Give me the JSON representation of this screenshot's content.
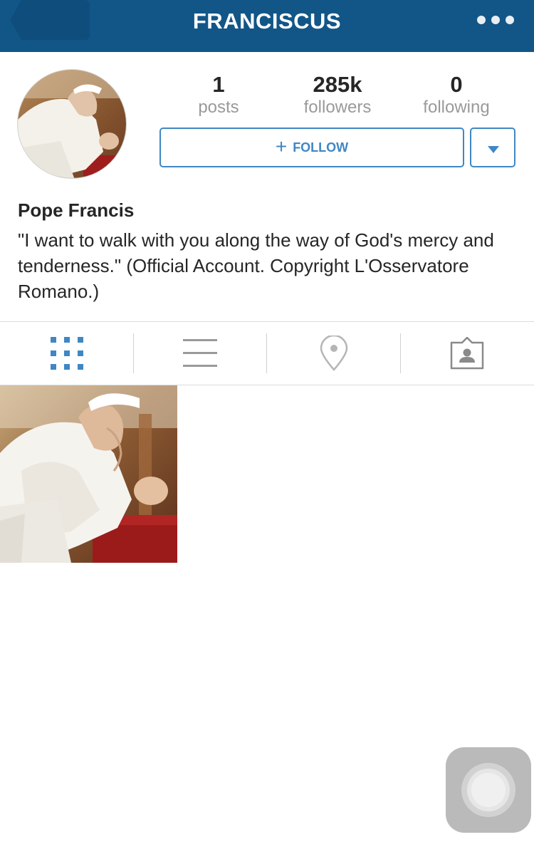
{
  "header": {
    "title": "FRANCISCUS",
    "bg_color": "#125688",
    "back_icon": "back-arrow-icon",
    "more_icon": "more-dots-icon"
  },
  "profile": {
    "avatar_alt": "profile photo",
    "stats": [
      {
        "value": "1",
        "label": "posts"
      },
      {
        "value": "285k",
        "label": "followers"
      },
      {
        "value": "0",
        "label": "following"
      }
    ],
    "follow_label": "FOLLOW",
    "follow_plus": "+",
    "accent_color": "#3f87c4",
    "name": "Pope Francis",
    "bio": "\"I want to walk with you along the way of God's mercy and tenderness.\" (Official Account. Copyright L'Osservatore Romano.)"
  },
  "tabs": [
    {
      "icon": "grid-view-icon",
      "active": true
    },
    {
      "icon": "list-view-icon",
      "active": false
    },
    {
      "icon": "location-pin-icon",
      "active": false
    },
    {
      "icon": "tagged-photos-icon",
      "active": false
    }
  ],
  "posts": [
    {
      "icon": "photo-thumbnail"
    }
  ]
}
